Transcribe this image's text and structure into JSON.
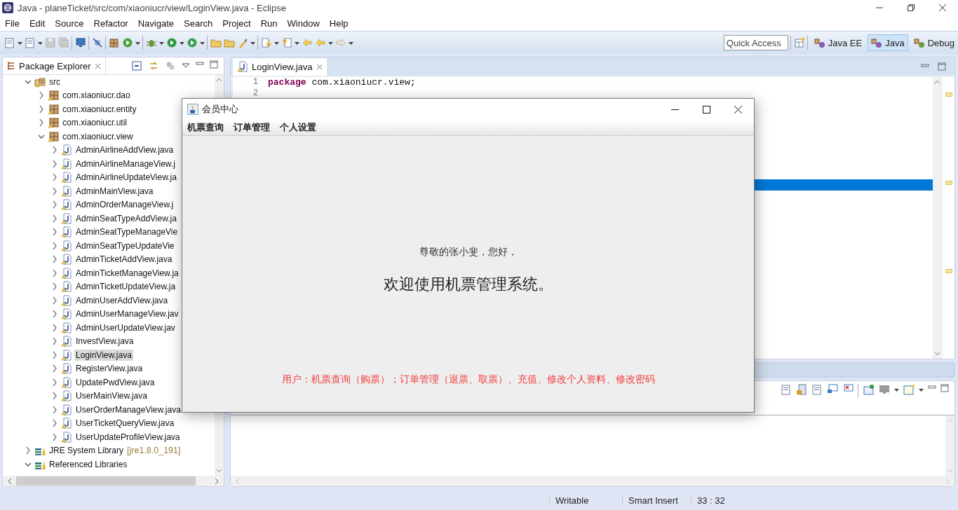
{
  "window": {
    "title": "Java - planeTicket/src/com/xiaoniucr/view/LoginView.java - Eclipse"
  },
  "menu": [
    "File",
    "Edit",
    "Source",
    "Refactor",
    "Navigate",
    "Search",
    "Project",
    "Run",
    "Window",
    "Help"
  ],
  "quick_access": {
    "placeholder": "Quick Access"
  },
  "perspectives": [
    {
      "label": "Java EE",
      "selected": false
    },
    {
      "label": "Java",
      "selected": true
    },
    {
      "label": "Debug",
      "selected": false
    }
  ],
  "package_explorer": {
    "title": "Package Explorer",
    "tree": [
      {
        "label": "src",
        "kind": "folder",
        "expanded": true,
        "selected": false,
        "children": [
          {
            "label": "com.xiaoniucr.dao",
            "kind": "package",
            "expanded": false,
            "selected": false
          },
          {
            "label": "com.xiaoniucr.entity",
            "kind": "package",
            "expanded": false,
            "selected": false
          },
          {
            "label": "com.xiaoniucr.util",
            "kind": "package",
            "expanded": false,
            "selected": false
          },
          {
            "label": "com.xiaoniucr.view",
            "kind": "package",
            "expanded": true,
            "selected": false,
            "children": [
              {
                "label": "AdminAirlineAddView.java",
                "kind": "file",
                "expanded": false,
                "selected": false
              },
              {
                "label": "AdminAirlineManageView.j",
                "kind": "file",
                "expanded": false,
                "selected": false
              },
              {
                "label": "AdminAirlineUpdateView.ja",
                "kind": "file",
                "expanded": false,
                "selected": false
              },
              {
                "label": "AdminMainView.java",
                "kind": "file",
                "expanded": false,
                "selected": false
              },
              {
                "label": "AdminOrderManageView.j",
                "kind": "file",
                "expanded": false,
                "selected": false
              },
              {
                "label": "AdminSeatTypeAddView.ja",
                "kind": "file",
                "expanded": false,
                "selected": false
              },
              {
                "label": "AdminSeatTypeManageVie",
                "kind": "file",
                "expanded": false,
                "selected": false
              },
              {
                "label": "AdminSeatTypeUpdateVie",
                "kind": "file",
                "expanded": false,
                "selected": false
              },
              {
                "label": "AdminTicketAddView.java",
                "kind": "file",
                "expanded": false,
                "selected": false
              },
              {
                "label": "AdminTicketManageView.ja",
                "kind": "file",
                "expanded": false,
                "selected": false
              },
              {
                "label": "AdminTicketUpdateView.ja",
                "kind": "file",
                "expanded": false,
                "selected": false
              },
              {
                "label": "AdminUserAddView.java",
                "kind": "file",
                "expanded": false,
                "selected": false
              },
              {
                "label": "AdminUserManageView.jav",
                "kind": "file",
                "expanded": false,
                "selected": false
              },
              {
                "label": "AdminUserUpdateView.jav",
                "kind": "file",
                "expanded": false,
                "selected": false
              },
              {
                "label": "InvestView.java",
                "kind": "file",
                "expanded": false,
                "selected": false
              },
              {
                "label": "LoginView.java",
                "kind": "file",
                "expanded": false,
                "selected": true
              },
              {
                "label": "RegisterView.java",
                "kind": "file",
                "expanded": false,
                "selected": false
              },
              {
                "label": "UpdatePwdView.java",
                "kind": "file",
                "expanded": false,
                "selected": false
              },
              {
                "label": "UserMainView.java",
                "kind": "file",
                "expanded": false,
                "selected": false
              },
              {
                "label": "UserOrderManageView.java",
                "kind": "file",
                "expanded": false,
                "selected": false
              },
              {
                "label": "UserTicketQueryView.java",
                "kind": "file",
                "expanded": false,
                "selected": false
              },
              {
                "label": "UserUpdateProfileView.java",
                "kind": "file",
                "expanded": false,
                "selected": false
              }
            ]
          }
        ]
      },
      {
        "label": "JRE System Library",
        "decoration": "[jre1.8.0_191]",
        "kind": "library",
        "expanded": false,
        "selected": false
      },
      {
        "label": "Referenced Libraries",
        "kind": "library",
        "expanded": true,
        "selected": false
      }
    ]
  },
  "editor": {
    "tab": "LoginView.java",
    "lines": [
      {
        "number": "1",
        "code": "**package** com.xiaoniucr.view;"
      },
      {
        "number": "2"
      }
    ]
  },
  "dialog": {
    "title": "会员中心",
    "menu": [
      "机票查询",
      "订单管理",
      "个人设置"
    ],
    "greeting": "尊敬的张小斐，您好，",
    "welcome": "欢迎使用机票管理系统。",
    "note": "用户：机票查询（购票）；订单管理（退票、取票）、充值、修改个人资料、修改密码"
  },
  "status_bar": [
    "Writable",
    "Smart Insert",
    "33 : 32"
  ]
}
